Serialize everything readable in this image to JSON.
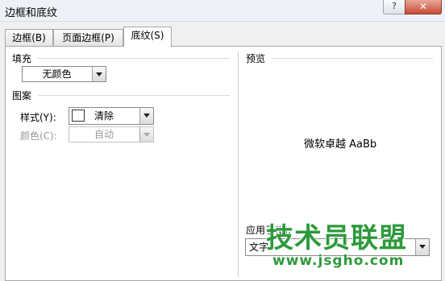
{
  "window": {
    "title": "边框和底纹",
    "help_label": "?",
    "close_label": "✕"
  },
  "tabs": [
    {
      "label": "边框(B)"
    },
    {
      "label": "页面边框(P)"
    },
    {
      "label": "底纹(S)"
    }
  ],
  "fill": {
    "section_label": "填充",
    "color_value": "无颜色"
  },
  "pattern": {
    "section_label": "图案",
    "style_label": "样式(Y):",
    "style_value": "清除",
    "color_label": "颜色(C):",
    "color_value": "自动"
  },
  "preview": {
    "section_label": "预览",
    "sample_text": "微软卓越 AaBb"
  },
  "apply_to": {
    "label": "应用于(L):",
    "value": "文字"
  },
  "watermark": {
    "main": "技术员联盟",
    "url": "www.jsgho.com"
  }
}
